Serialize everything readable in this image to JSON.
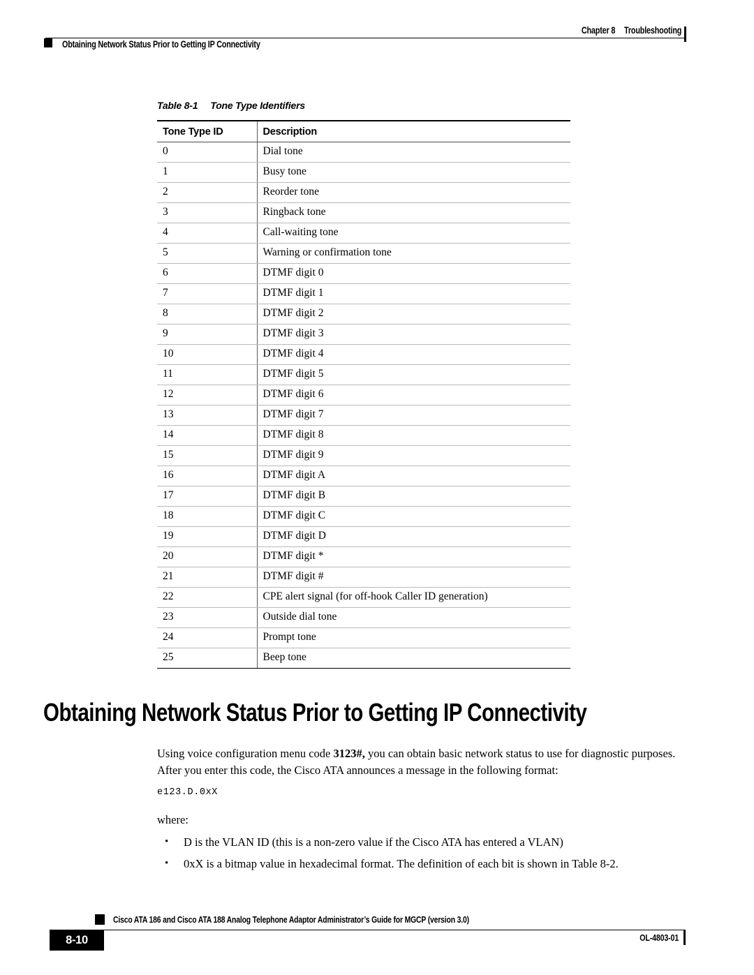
{
  "header": {
    "chapter": "Chapter 8",
    "chapter_title": "Troubleshooting",
    "running_title": "Obtaining Network Status Prior to Getting IP Connectivity"
  },
  "table": {
    "caption_number": "Table 8-1",
    "caption_title": "Tone Type Identifiers",
    "columns": [
      "Tone Type ID",
      "Description"
    ],
    "rows": [
      {
        "id": "0",
        "description": "Dial tone"
      },
      {
        "id": "1",
        "description": "Busy tone"
      },
      {
        "id": "2",
        "description": "Reorder tone"
      },
      {
        "id": "3",
        "description": "Ringback tone"
      },
      {
        "id": "4",
        "description": "Call-waiting tone"
      },
      {
        "id": "5",
        "description": "Warning or confirmation tone"
      },
      {
        "id": "6",
        "description": "DTMF digit 0"
      },
      {
        "id": "7",
        "description": "DTMF digit 1"
      },
      {
        "id": "8",
        "description": "DTMF digit 2"
      },
      {
        "id": "9",
        "description": "DTMF digit 3"
      },
      {
        "id": "10",
        "description": "DTMF digit 4"
      },
      {
        "id": "11",
        "description": "DTMF digit 5"
      },
      {
        "id": "12",
        "description": "DTMF digit 6"
      },
      {
        "id": "13",
        "description": "DTMF digit 7"
      },
      {
        "id": "14",
        "description": "DTMF digit 8"
      },
      {
        "id": "15",
        "description": "DTMF digit 9"
      },
      {
        "id": "16",
        "description": "DTMF digit A"
      },
      {
        "id": "17",
        "description": "DTMF digit B"
      },
      {
        "id": "18",
        "description": "DTMF digit C"
      },
      {
        "id": "19",
        "description": "DTMF digit D"
      },
      {
        "id": "20",
        "description": "DTMF digit *"
      },
      {
        "id": "21",
        "description": "DTMF digit #"
      },
      {
        "id": "22",
        "description": "CPE alert signal (for off-hook Caller ID generation)"
      },
      {
        "id": "23",
        "description": "Outside dial tone"
      },
      {
        "id": "24",
        "description": "Prompt tone"
      },
      {
        "id": "25",
        "description": "Beep tone"
      }
    ]
  },
  "section": {
    "heading": "Obtaining Network Status Prior to Getting IP Connectivity",
    "paragraph_part1": "Using voice configuration menu code ",
    "paragraph_code": "3123#,",
    "paragraph_part2": " you can obtain basic network status to use for diagnostic purposes. After you enter this code, the Cisco ATA announces a message in the following format:",
    "code_sample": "e123.D.0xX",
    "where_label": "where:",
    "bullets": [
      "D is the VLAN ID (this is a non-zero value if the Cisco ATA has entered a VLAN)",
      "0xX is a bitmap value in hexadecimal format. The definition of each bit is shown in Table 8-2."
    ]
  },
  "footer": {
    "guide_title": "Cisco ATA 186 and Cisco ATA 188 Analog Telephone Adaptor Administrator’s Guide for MGCP (version 3.0)",
    "page_number": "8-10",
    "document_number": "OL-4803-01"
  }
}
